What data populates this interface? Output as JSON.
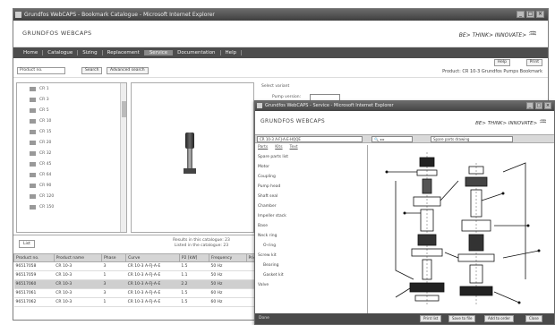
{
  "main": {
    "title": "Grundfos WebCAPS - Bookmark Catalogue - Microsoft Internet Explorer",
    "app_name": "GRUNDFOS WEBCAPS",
    "brand": "BE> THINK> INNOVATE>",
    "menu": [
      "Home",
      "Catalogue",
      "Sizing",
      "Replacement",
      "Service",
      "Documentation",
      "Help"
    ],
    "active_menu": "Service",
    "search_value": "Product no.",
    "search_button": "Search",
    "advanced_button": "Advanced search",
    "top_buttons": [
      "Help",
      "Print"
    ],
    "info": "Product: CR 10-3   Grundfos Pumps   Bookmark",
    "tree_items": [
      "CR 1",
      "CR 3",
      "CR 5",
      "CR 10",
      "CR 15",
      "CR 20",
      "CR 32",
      "CR 45",
      "CR 64",
      "CR 90",
      "CR 120",
      "CR 150"
    ],
    "right_heading": "Select variant",
    "right_label": "Pump version:",
    "list_button": "List",
    "summary": [
      "Results in this catalogue: 23",
      "Listed in the catalogue: 23"
    ],
    "columns": [
      "Product no.",
      "Product name",
      "Phase",
      "Curve",
      "P2 [kW]",
      "Frequency",
      "Price"
    ],
    "rows": [
      [
        "96517058",
        "CR 10-3",
        "3",
        "CR 10-3 A-FJ-A-E",
        "1.5",
        "50 Hz",
        ""
      ],
      [
        "96517059",
        "CR 10-3",
        "1",
        "CR 10-3 A-FJ-A-E",
        "1.1",
        "50 Hz",
        ""
      ],
      [
        "96517060",
        "CR 10-3",
        "3",
        "CR 10-3 A-FJ-A-E",
        "2.2",
        "50 Hz",
        ""
      ],
      [
        "96517061",
        "CR 10-3",
        "3",
        "CR 10-3 A-FJ-A-E",
        "1.5",
        "60 Hz",
        ""
      ],
      [
        "96517062",
        "CR 10-3",
        "1",
        "CR 10-3 A-FJ-A-E",
        "1.5",
        "60 Hz",
        ""
      ]
    ]
  },
  "popup": {
    "title": "Grundfos WebCAPS - Service - Microsoft Internet Explorer",
    "app_name": "GRUNDFOS WEBCAPS",
    "brand": "BE> THINK> INNOVATE>",
    "product_field": "CR 10-3 A-FJ-A-E-HQQE",
    "drawing_field": "Spare parts drawing",
    "tabs": [
      "Parts",
      "Kits",
      "Text"
    ],
    "list_title": "Spare parts list",
    "list": [
      "Motor",
      "Coupling",
      "Pump head",
      "Shaft seal",
      "Chamber",
      "Impeller stack",
      "Base",
      "Neck ring",
      "O-ring",
      "Screw kit",
      "Bearing",
      "Gasket kit",
      "Valve"
    ],
    "status": "Done",
    "buttons": [
      "Print list",
      "Save to file",
      "Add to order",
      "Close"
    ]
  }
}
